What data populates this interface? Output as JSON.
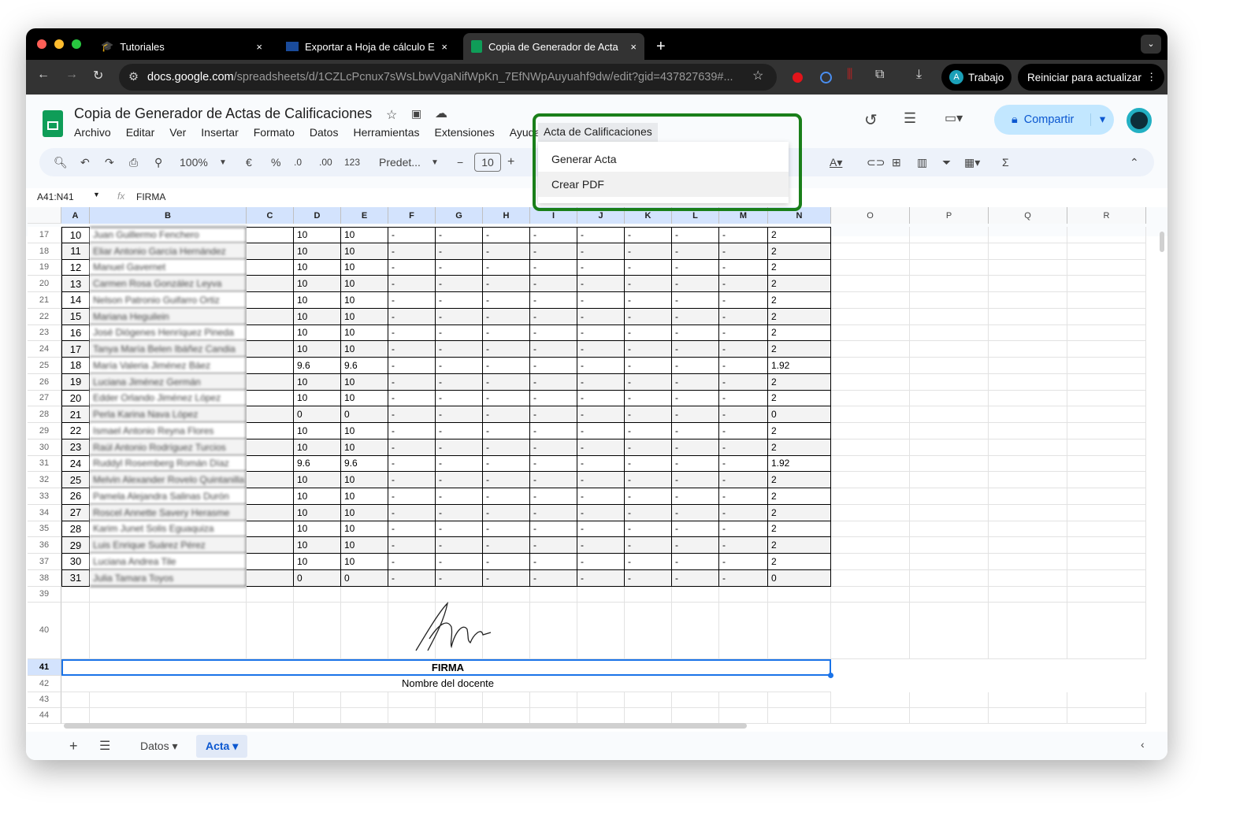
{
  "browser": {
    "tabs": [
      {
        "title": "Tutoriales",
        "close": "×"
      },
      {
        "title": "Exportar a Hoja de cálculo Ex",
        "close": "×"
      },
      {
        "title": "Copia de Generador de Actas",
        "close": "×"
      }
    ],
    "new_tab": "+",
    "url_host": "docs.google.com",
    "url_path": "/spreadsheets/d/1CZLcPcnux7sWsLbwVgaNifWpKn_7EfNWpAuyuahf9dw/edit?gid=437827639#...",
    "profile_initial": "A",
    "profile_label": "Trabajo",
    "update_label": "Reiniciar para actualizar"
  },
  "doc": {
    "title": "Copia de Generador de Actas de Calificaciones",
    "menu": [
      "Archivo",
      "Editar",
      "Ver",
      "Insertar",
      "Formato",
      "Datos",
      "Herramientas",
      "Extensiones",
      "Ayuda"
    ],
    "custom_menu": "Acta de Calificaciones",
    "custom_menu_items": [
      "Generar Acta",
      "Crear PDF"
    ],
    "share_label": "Compartir",
    "toolbar": {
      "zoom": "100%",
      "currency": "€",
      "percent": "%",
      "dec_less": ".0",
      "dec_more": ".00",
      "format": "123",
      "font": "Predet...",
      "font_size": "10"
    },
    "name_box": "A41:N41",
    "formula": "FIRMA",
    "fx": "fx"
  },
  "grid": {
    "columns": [
      "A",
      "B",
      "C",
      "D",
      "E",
      "F",
      "G",
      "H",
      "I",
      "J",
      "K",
      "L",
      "M",
      "N",
      "O",
      "P",
      "Q",
      "R"
    ],
    "rows": [
      {
        "r": "17",
        "a": "10",
        "b": "Juan Guillermo Fenchero",
        "d": "10",
        "e": "10",
        "n": "2"
      },
      {
        "r": "18",
        "a": "11",
        "b": "Eliar Antonio García Hernández",
        "d": "10",
        "e": "10",
        "n": "2"
      },
      {
        "r": "19",
        "a": "12",
        "b": "Manuel Gavernet",
        "d": "10",
        "e": "10",
        "n": "2"
      },
      {
        "r": "20",
        "a": "13",
        "b": "Carmen Rosa González Leyva",
        "d": "10",
        "e": "10",
        "n": "2"
      },
      {
        "r": "21",
        "a": "14",
        "b": "Nelson Patronio Guifarro Ortiz",
        "d": "10",
        "e": "10",
        "n": "2"
      },
      {
        "r": "22",
        "a": "15",
        "b": "Mariana Heguilein",
        "d": "10",
        "e": "10",
        "n": "2"
      },
      {
        "r": "23",
        "a": "16",
        "b": "José Diógenes Henríquez Pineda",
        "d": "10",
        "e": "10",
        "n": "2"
      },
      {
        "r": "24",
        "a": "17",
        "b": "Tanya María Belen Ibáñez Candia",
        "d": "10",
        "e": "10",
        "n": "2"
      },
      {
        "r": "25",
        "a": "18",
        "b": "María Valeria Jiménez Báez",
        "d": "9.6",
        "e": "9.6",
        "n": "1.92"
      },
      {
        "r": "26",
        "a": "19",
        "b": "Luciana Jiménez Germán",
        "d": "10",
        "e": "10",
        "n": "2"
      },
      {
        "r": "27",
        "a": "20",
        "b": "Edder Orlando Jiménez López",
        "d": "10",
        "e": "10",
        "n": "2"
      },
      {
        "r": "28",
        "a": "21",
        "b": "Perla Karina Nava López",
        "d": "0",
        "e": "0",
        "n": "0"
      },
      {
        "r": "29",
        "a": "22",
        "b": "Ismael Antonio Reyna Flores",
        "d": "10",
        "e": "10",
        "n": "2"
      },
      {
        "r": "30",
        "a": "23",
        "b": "Raúl Antonio Rodríguez Turcios",
        "d": "10",
        "e": "10",
        "n": "2"
      },
      {
        "r": "31",
        "a": "24",
        "b": "Ruddyl Rosemberg Román Díaz",
        "d": "9.6",
        "e": "9.6",
        "n": "1.92"
      },
      {
        "r": "32",
        "a": "25",
        "b": "Melvin Alexander Rovelo Quintanilla",
        "d": "10",
        "e": "10",
        "n": "2"
      },
      {
        "r": "33",
        "a": "26",
        "b": "Pamela Alejandra Salinas Durón",
        "d": "10",
        "e": "10",
        "n": "2"
      },
      {
        "r": "34",
        "a": "27",
        "b": "Roscel Annette Savery Herasme",
        "d": "10",
        "e": "10",
        "n": "2"
      },
      {
        "r": "35",
        "a": "28",
        "b": "Karim Junet Solis Eguaquiza",
        "d": "10",
        "e": "10",
        "n": "2"
      },
      {
        "r": "36",
        "a": "29",
        "b": "Luis Enrique Suárez Pérez",
        "d": "10",
        "e": "10",
        "n": "2"
      },
      {
        "r": "37",
        "a": "30",
        "b": "Luciana Andrea Tile",
        "d": "10",
        "e": "10",
        "n": "2"
      },
      {
        "r": "38",
        "a": "31",
        "b": "Julia Tamara Toyos",
        "d": "0",
        "e": "0",
        "n": "0"
      }
    ],
    "dash": "-",
    "extra_rows": [
      "39",
      "40",
      "41",
      "42",
      "43",
      "44"
    ],
    "firma": "FIRMA",
    "docente": "Nombre del docente"
  },
  "sheets": {
    "tabs": [
      "Datos",
      "Acta"
    ],
    "active": "Acta",
    "add": "+"
  }
}
